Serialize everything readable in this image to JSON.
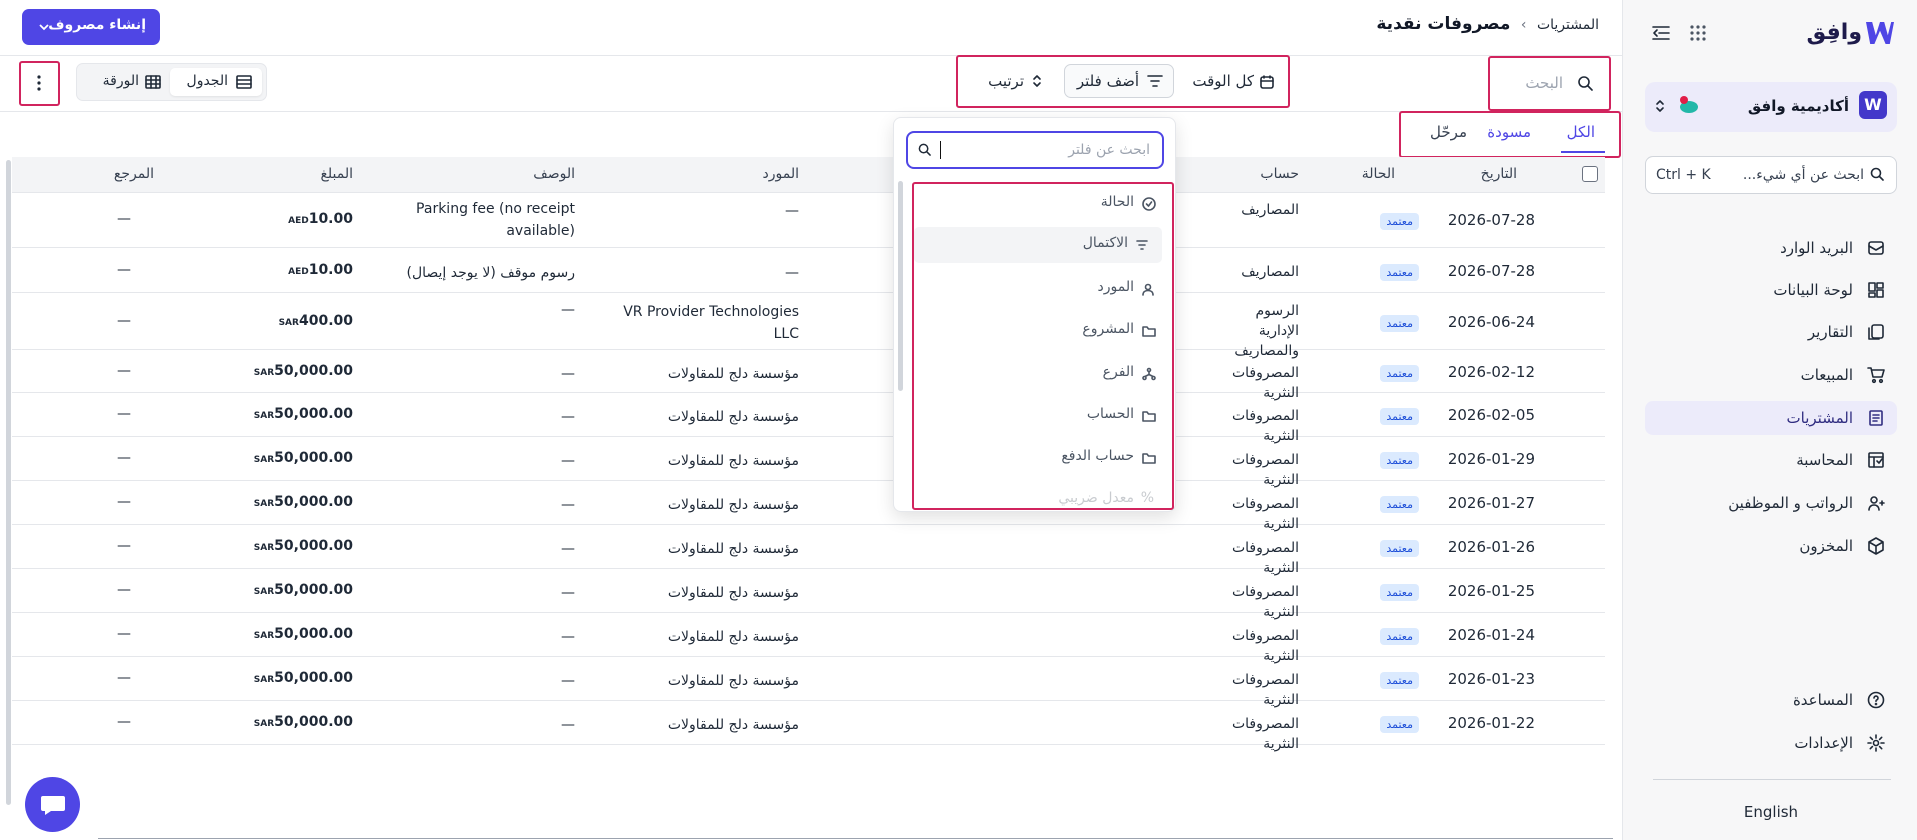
{
  "sidebar": {
    "brand": "وافِق",
    "org_logo": "W",
    "org_name": "أكاديمية وافق",
    "search_placeholder": "ابحث عن أي شيء...",
    "search_shortcut": "Ctrl + K",
    "items": [
      {
        "label": "البريد الوارد",
        "icon": "inbox-icon"
      },
      {
        "label": "لوحة البيانات",
        "icon": "dashboard-icon"
      },
      {
        "label": "التقارير",
        "icon": "reports-icon"
      },
      {
        "label": "المبيعات",
        "icon": "cart-icon"
      },
      {
        "label": "المشتريات",
        "icon": "receipt-icon",
        "active": true
      },
      {
        "label": "المحاسبة",
        "icon": "ledger-icon"
      },
      {
        "label": "الرواتب و الموظفين",
        "icon": "users-icon"
      },
      {
        "label": "المخزون",
        "icon": "box-icon"
      }
    ],
    "help": "المساعدة",
    "settings": "الإعدادات",
    "language": "English"
  },
  "header": {
    "breadcrumb_parent": "المشتريات",
    "breadcrumb_sep": "›",
    "title": "مصروفات نقدية",
    "create_label": "إنشاء مصروف"
  },
  "toolbar": {
    "search_placeholder": "البحث",
    "date_filter": "كل الوقت",
    "add_filter": "أضف فلتر",
    "sort": "ترتيب",
    "view_table": "الجدول",
    "view_sheet": "الورقة"
  },
  "tabs": [
    "الكل",
    "مسودة",
    "مرحّل"
  ],
  "filter_dropdown": {
    "search_placeholder": "ابحث عن فلتر",
    "items": [
      "الحالة",
      "الاكتمال",
      "المورد",
      "المشروع",
      "الفرع",
      "الحساب",
      "حساب الدفع",
      "معدل ضريبي"
    ]
  },
  "table": {
    "columns": {
      "date": "التاريخ",
      "status": "الحالة",
      "account": "حساب",
      "vendor": "المورد",
      "description": "الوصف",
      "amount": "المبلغ",
      "reference": "المرجع"
    },
    "rows": [
      {
        "date": "2026-07-28",
        "status": "معتمد",
        "account": "المصاريف",
        "vendor": "—",
        "description": "Parking fee (no receipt available)",
        "amount": "10.00",
        "currency": "AED",
        "reference": "—"
      },
      {
        "date": "2026-07-28",
        "status": "معتمد",
        "account": "المصاريف",
        "vendor": "—",
        "description": "رسوم موقف (لا يوجد إيصال)",
        "amount": "10.00",
        "currency": "AED",
        "reference": "—"
      },
      {
        "date": "2026-06-24",
        "status": "معتمد",
        "account": "الرسوم الإدارية والمصاريف",
        "vendor": "VR Provider Technologies LLC",
        "description": "—",
        "amount": "400.00",
        "currency": "SAR",
        "reference": "—"
      },
      {
        "date": "2026-02-12",
        "status": "معتمد",
        "account": "المصروفات النثرية",
        "vendor": "مؤسسة دلج للمقاولات",
        "description": "—",
        "amount": "50,000.00",
        "currency": "SAR",
        "reference": "—"
      },
      {
        "date": "2026-02-05",
        "status": "معتمد",
        "account": "المصروفات النثرية",
        "vendor": "مؤسسة دلج للمقاولات",
        "description": "—",
        "amount": "50,000.00",
        "currency": "SAR",
        "reference": "—"
      },
      {
        "date": "2026-01-29",
        "status": "معتمد",
        "account": "المصروفات النثرية",
        "vendor": "مؤسسة دلج للمقاولات",
        "description": "—",
        "amount": "50,000.00",
        "currency": "SAR",
        "reference": "—"
      },
      {
        "date": "2026-01-27",
        "status": "معتمد",
        "account": "المصروفات النثرية",
        "vendor": "مؤسسة دلج للمقاولات",
        "description": "—",
        "amount": "50,000.00",
        "currency": "SAR",
        "reference": "—"
      },
      {
        "date": "2026-01-26",
        "status": "معتمد",
        "account": "المصروفات النثرية",
        "vendor": "مؤسسة دلج للمقاولات",
        "description": "—",
        "amount": "50,000.00",
        "currency": "SAR",
        "reference": "—"
      },
      {
        "date": "2026-01-25",
        "status": "معتمد",
        "account": "المصروفات النثرية",
        "vendor": "مؤسسة دلج للمقاولات",
        "description": "—",
        "amount": "50,000.00",
        "currency": "SAR",
        "reference": "—"
      },
      {
        "date": "2026-01-24",
        "status": "معتمد",
        "account": "المصروفات النثرية",
        "vendor": "مؤسسة دلج للمقاولات",
        "description": "—",
        "amount": "50,000.00",
        "currency": "SAR",
        "reference": "—"
      },
      {
        "date": "2026-01-23",
        "status": "معتمد",
        "account": "المصروفات النثرية",
        "vendor": "مؤسسة دلج للمقاولات",
        "description": "—",
        "amount": "50,000.00",
        "currency": "SAR",
        "reference": "—"
      },
      {
        "date": "2026-01-22",
        "status": "معتمد",
        "account": "المصروفات النثرية",
        "vendor": "مؤسسة دلج للمقاولات",
        "description": "—",
        "amount": "50,000.00",
        "currency": "SAR",
        "reference": "—"
      }
    ]
  },
  "colors": {
    "accent": "#4f46e5",
    "highlight": "#d1245e",
    "badge_bg": "#dbeafe",
    "badge_text": "#1d4ed8"
  }
}
